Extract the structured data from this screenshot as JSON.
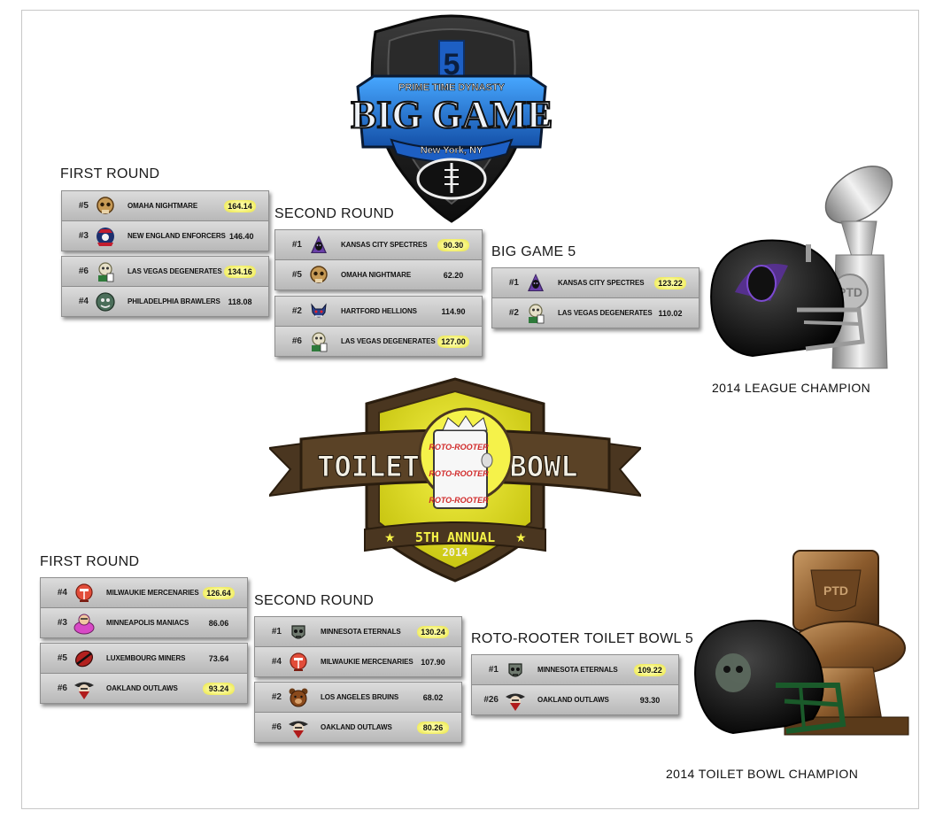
{
  "big_game": {
    "logo": {
      "number": "5",
      "league": "PRIME TIME DYNASTY",
      "name": "BIG GAME",
      "city": "New York, NY"
    },
    "first_round": {
      "title": "FIRST ROUND",
      "matchups": [
        [
          {
            "seed": "#5",
            "team": "OMAHA NIGHTMARE",
            "score": "164.14",
            "winner": true,
            "icon": "skull-icon"
          },
          {
            "seed": "#3",
            "team": "NEW ENGLAND ENFORCERS",
            "score": "146.40",
            "winner": false,
            "icon": "patriot-icon"
          }
        ],
        [
          {
            "seed": "#6",
            "team": "LAS VEGAS DEGENERATES",
            "score": "134.16",
            "winner": true,
            "icon": "gambler-icon"
          },
          {
            "seed": "#4",
            "team": "PHILADELPHIA BRAWLERS",
            "score": "118.08",
            "winner": false,
            "icon": "brawler-icon"
          }
        ]
      ]
    },
    "second_round": {
      "title": "SECOND ROUND",
      "matchups": [
        [
          {
            "seed": "#1",
            "team": "KANSAS CITY SPECTRES",
            "score": "90.30",
            "winner": true,
            "icon": "spectre-icon"
          },
          {
            "seed": "#5",
            "team": "OMAHA NIGHTMARE",
            "score": "62.20",
            "winner": false,
            "icon": "skull-icon"
          }
        ],
        [
          {
            "seed": "#2",
            "team": "HARTFORD HELLIONS",
            "score": "114.90",
            "winner": false,
            "icon": "hellion-icon"
          },
          {
            "seed": "#6",
            "team": "LAS VEGAS DEGENERATES",
            "score": "127.00",
            "winner": true,
            "icon": "gambler-icon"
          }
        ]
      ]
    },
    "final": {
      "title": "BIG GAME 5",
      "matchup": [
        {
          "seed": "#1",
          "team": "KANSAS CITY SPECTRES",
          "score": "123.22",
          "winner": true,
          "icon": "spectre-icon"
        },
        {
          "seed": "#2",
          "team": "LAS VEGAS DEGENERATES",
          "score": "110.02",
          "winner": false,
          "icon": "gambler-icon"
        }
      ]
    },
    "champion_caption": "2014 LEAGUE CHAMPION",
    "trophy_badge": "PTD"
  },
  "toilet_bowl": {
    "logo": {
      "left": "TOILET",
      "right": "BOWL",
      "annual": "5TH ANNUAL",
      "year": "2014",
      "sponsor": "ROTO-ROOTER"
    },
    "first_round": {
      "title": "FIRST ROUND",
      "matchups": [
        [
          {
            "seed": "#4",
            "team": "MILWAUKIE MERCENARIES",
            "score": "126.64",
            "winner": true,
            "icon": "mercenary-icon"
          },
          {
            "seed": "#3",
            "team": "MINNEAPOLIS MANIACS",
            "score": "86.06",
            "winner": false,
            "icon": "maniac-icon"
          }
        ],
        [
          {
            "seed": "#5",
            "team": "LUXEMBOURG MINERS",
            "score": "73.64",
            "winner": false,
            "icon": "miner-icon"
          },
          {
            "seed": "#6",
            "team": "OAKLAND OUTLAWS",
            "score": "93.24",
            "winner": true,
            "icon": "outlaw-icon"
          }
        ]
      ]
    },
    "second_round": {
      "title": "SECOND ROUND",
      "matchups": [
        [
          {
            "seed": "#1",
            "team": "MINNESOTA ETERNALS",
            "score": "130.24",
            "winner": true,
            "icon": "eternal-icon"
          },
          {
            "seed": "#4",
            "team": "MILWAUKIE MERCENARIES",
            "score": "107.90",
            "winner": false,
            "icon": "mercenary-icon"
          }
        ],
        [
          {
            "seed": "#2",
            "team": "LOS ANGELES BRUINS",
            "score": "68.02",
            "winner": false,
            "icon": "bear-icon"
          },
          {
            "seed": "#6",
            "team": "OAKLAND OUTLAWS",
            "score": "80.26",
            "winner": true,
            "icon": "outlaw-icon"
          }
        ]
      ]
    },
    "final": {
      "title": "ROTO-ROOTER TOILET BOWL 5",
      "matchup": [
        {
          "seed": "#1",
          "team": "MINNESOTA ETERNALS",
          "score": "109.22",
          "winner": true,
          "icon": "eternal-icon"
        },
        {
          "seed": "#26",
          "team": "OAKLAND OUTLAWS",
          "score": "93.30",
          "winner": false,
          "icon": "outlaw-icon"
        }
      ]
    },
    "champion_caption": "2014 TOILET BOWL CHAMPION",
    "trophy_badge": "PTD"
  },
  "colors": {
    "winner_highlight": "#f4f07a",
    "box_gray": "#c6c6c6",
    "big_game_blue": "#1f6fd1",
    "toilet_yellow": "#e3e020",
    "toilet_brown": "#4a3620"
  }
}
